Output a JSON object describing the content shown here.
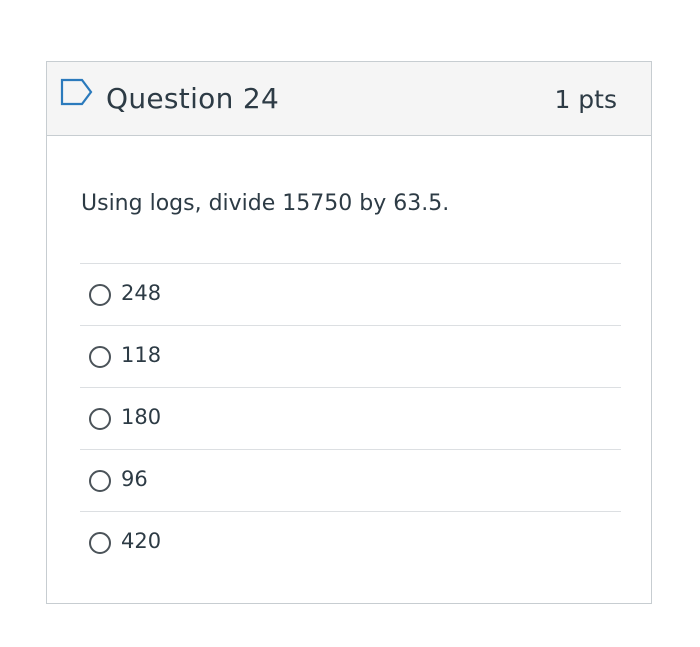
{
  "question": {
    "title": "Question 24",
    "points": "1 pts",
    "text": "Using logs, divide 15750 by 63.5.",
    "flag_icon": "flag-outline-icon"
  },
  "answers": [
    {
      "label": "248",
      "selected": false
    },
    {
      "label": "118",
      "selected": false
    },
    {
      "label": "180",
      "selected": false
    },
    {
      "label": "96",
      "selected": false
    },
    {
      "label": "420",
      "selected": false
    }
  ],
  "colors": {
    "text": "#2d3b45",
    "header_bg": "#f5f5f5",
    "border": "#c7cdd1",
    "divider": "#dcdfe2",
    "flag": "#2b7abc"
  }
}
